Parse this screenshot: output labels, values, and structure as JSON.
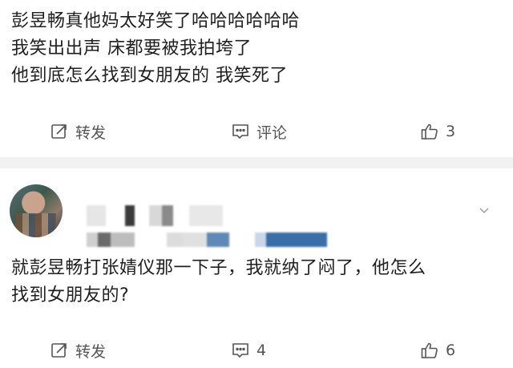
{
  "post1": {
    "lines": [
      "彭昱畅真他妈太好笑了哈哈哈哈哈哈",
      "我笑出出声 床都要被我拍垮了",
      "他到底怎么找到女朋友的 我笑死了"
    ],
    "actions": {
      "repost": "转发",
      "comment": "评论",
      "like": "3"
    }
  },
  "post2": {
    "lines": [
      "就彭昱畅打张婧仪那一下子，我就纳了闷了，他怎么",
      "找到女朋友的?"
    ],
    "actions": {
      "repost": "转发",
      "comment": "4",
      "like": "6"
    }
  },
  "icons": {
    "repost": "repost-icon",
    "comment": "comment-icon",
    "like": "thumbs-up-icon",
    "more": "chevron-down-icon"
  }
}
